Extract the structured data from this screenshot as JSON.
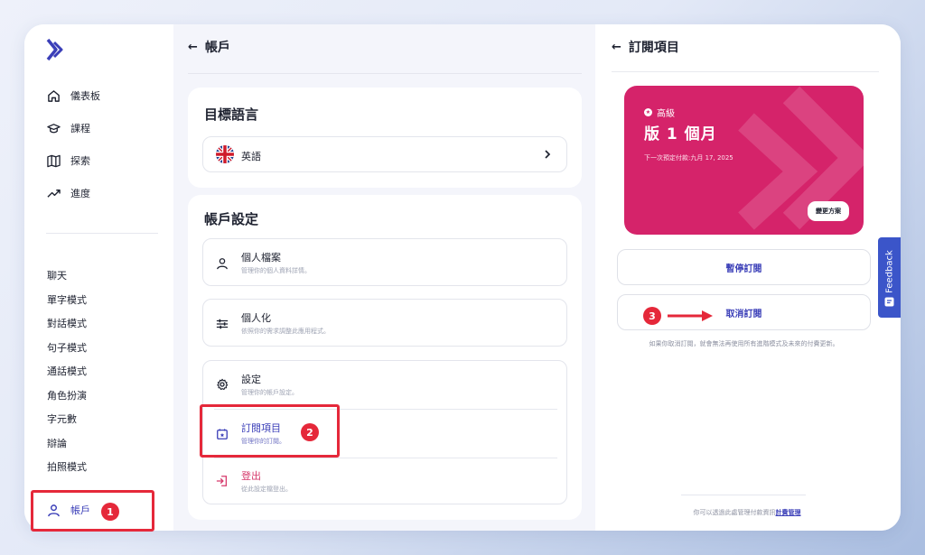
{
  "sidebar": {
    "nav": [
      {
        "label": "儀表板",
        "icon": "home-icon"
      },
      {
        "label": "課程",
        "icon": "graduation-cap-icon"
      },
      {
        "label": "探索",
        "icon": "map-icon"
      },
      {
        "label": "進度",
        "icon": "trending-up-icon"
      }
    ],
    "modes": [
      "聊天",
      "單字模式",
      "對話模式",
      "句子模式",
      "通話模式",
      "角色扮演",
      "字元數",
      "辯論",
      "拍照模式"
    ],
    "account_label": "帳戶"
  },
  "middle": {
    "header": "帳戶",
    "language_card": {
      "title": "目標語言",
      "language": "英語"
    },
    "settings_card": {
      "title": "帳戶設定",
      "items": [
        {
          "title": "個人檔案",
          "subtitle": "管理你的個人資料詳情。"
        },
        {
          "title": "個人化",
          "subtitle": "依照你的需求調整此應用程式。"
        },
        {
          "title": "設定",
          "subtitle": "管理你的帳戶設定。"
        },
        {
          "title": "訂閱項目",
          "subtitle": "管理你的訂閱。"
        },
        {
          "title": "登出",
          "subtitle": "從此設定檔登出。"
        }
      ]
    }
  },
  "right": {
    "header": "訂閱項目",
    "plan": {
      "tier": "高級",
      "name": "版 1 個月",
      "next_payment": "下一次預定付款:九月 17, 2025",
      "change_label": "變更方案"
    },
    "pause_label": "暫停訂閱",
    "cancel_label": "取消訂閱",
    "cancel_note": "如果你取消訂閱，就會無法再使用所有進階模式及未來的付費更新。",
    "billing_note": "你可以透過此處管理付款資訊",
    "billing_link": "計費管理"
  },
  "annotations": {
    "badges": [
      "1",
      "2",
      "3"
    ]
  },
  "feedback_label": "Feedback",
  "colors": {
    "accent": "#3b3fb8",
    "plan_card": "#d5236a",
    "highlight": "#e5283a",
    "feedback": "#3b55c9"
  }
}
